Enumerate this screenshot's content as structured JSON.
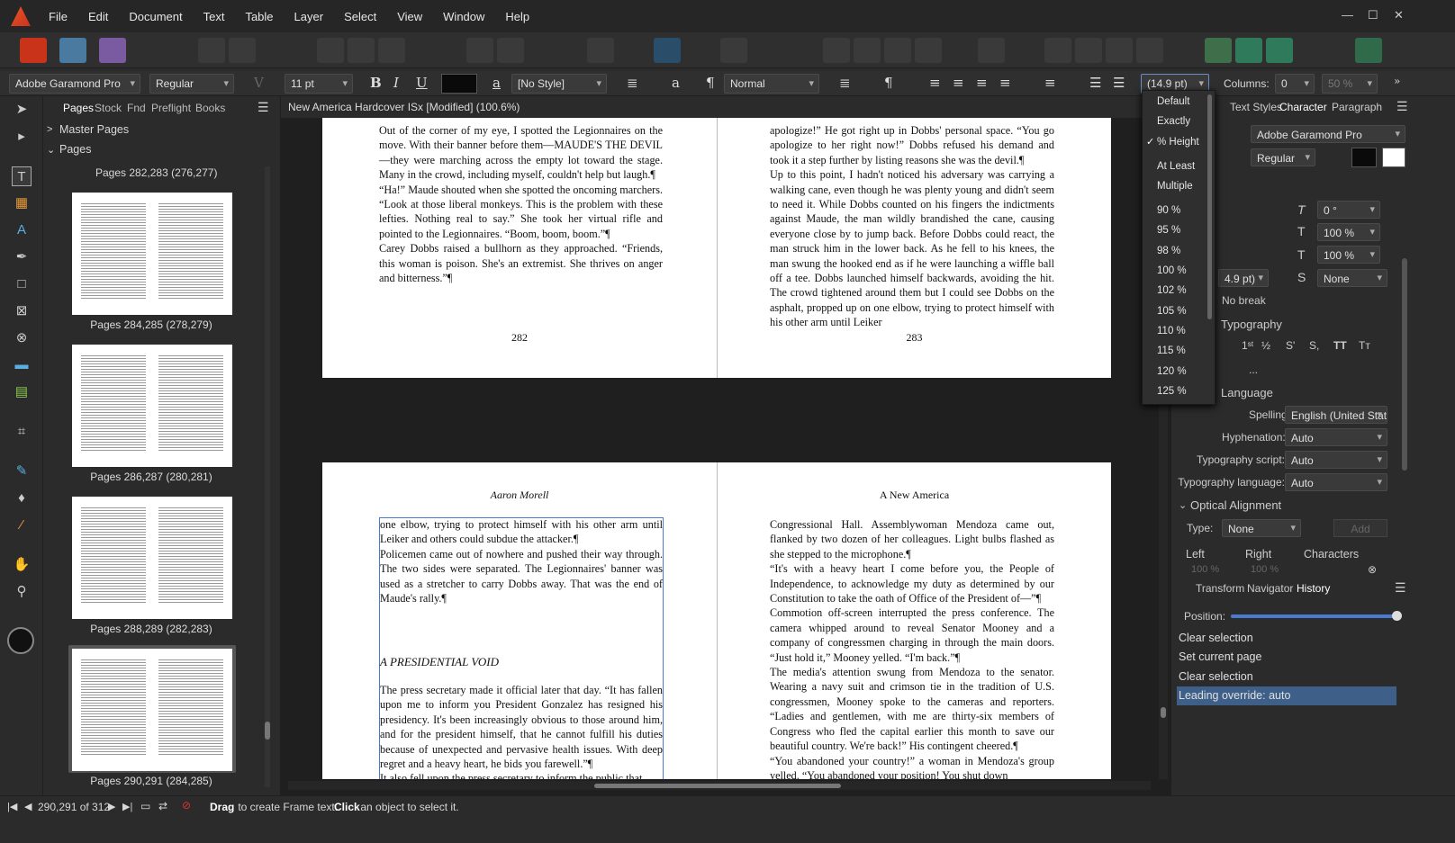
{
  "menu": {
    "items": [
      "File",
      "Edit",
      "Document",
      "Text",
      "Table",
      "Layer",
      "Select",
      "View",
      "Window",
      "Help"
    ]
  },
  "context_bar": {
    "font_family": "Adobe Garamond Pro",
    "font_style": "Regular",
    "font_size": "11 pt",
    "char_style": "[No Style]",
    "para_style": "Normal",
    "leading": "(14.9 pt)",
    "columns_label": "Columns:",
    "columns_value": "0",
    "zoom_pct": "50 %"
  },
  "left_panel": {
    "tabs": [
      "Pages",
      "Stock",
      "Fnd",
      "Preflight",
      "Books"
    ],
    "master_pages": "Master Pages",
    "pages": "Pages",
    "spreads": [
      "Pages 282,283 (276,277)",
      "Pages 284,285 (278,279)",
      "Pages 286,287 (280,281)",
      "Pages 288,289 (282,283)",
      "Pages 290,291 (284,285)"
    ]
  },
  "document": {
    "title": "New America Hardcover ISx [Modified] (100.6%)",
    "page282": "Out of the corner of my eye, I spotted the Legionnaires on the move. With their banner before them—MAUDE'S THE DEVIL—they were marching across the empty lot toward the stage. Many in the crowd, including myself, couldn't help but laugh.¶\n“Ha!” Maude shouted when she spotted the oncoming marchers. “Look at those liberal monkeys. This is the problem with these lefties. Nothing real to say.” She took her virtual rifle and pointed to the Legionnaires. “Boom, boom, boom.”¶\nCarey Dobbs raised a bullhorn as they approached. “Friends, this woman is poison. She's an extremist. She thrives on anger and bitterness.”¶",
    "page283": "apologize!” He got right up in Dobbs' personal space. “You go apologize to her right now!” Dobbs refused his demand and took it a step further by listing reasons she was the devil.¶\nUp to this point, I hadn't noticed his adversary was carrying a walking cane, even though he was plenty young and didn't seem to need it. While Dobbs counted on his fingers the indictments against Maude, the man wildly brandished the cane, causing everyone close by to jump back. Before Dobbs could react, the man struck him in the lower back. As he fell to his knees, the man swung the hooked end as if he were launching a wiffle ball off a tee. Dobbs launched himself backwards, avoiding the hit. The crowd tightened around them but I could see Dobbs on the asphalt, propped up on one elbow, trying to protect himself with his other arm until Leiker",
    "pn282": "282",
    "pn283": "283",
    "header_left": "Aaron Morell",
    "header_right": "A New America",
    "page284a": "one elbow, trying to protect himself with his other arm until Leiker and others could subdue the attacker.¶\nPolicemen came out of nowhere and pushed their way through. The two sides were separated. The Legionnaires' banner was used as a stretcher to carry Dobbs away. That was the end of Maude's rally.¶",
    "heading284": "A PRESIDENTIAL VOID",
    "page284b": "The press secretary made it official later that day. “It has fallen upon me to inform you President Gonzalez has resigned his presidency. It's been increasingly obvious to those around him, and for the president himself, that he cannot fulfill his duties because of unexpected and pervasive health issues. With deep regret and a heavy heart, he bids you farewell.”¶\nIt also fell upon the press secretary to inform the public that",
    "page285": "Congressional Hall. Assemblywoman Mendoza came out, flanked by two dozen of her colleagues. Light bulbs flashed as she stepped to the microphone.¶\n“It's with a heavy heart I come before you, the People of Independence, to acknowledge my duty as determined by our Constitution to take the oath of Office of the President of—”¶\nCommotion off-screen interrupted the press conference. The camera whipped around to reveal Senator Mooney and a company of congressmen charging in through the main doors. “Just hold it,” Mooney yelled. “I'm back.”¶\nThe media's attention swung from Mendoza to the senator. Wearing a navy suit and crimson tie in the tradition of U.S. congressmen, Mooney spoke to the cameras and reporters. “Ladies and gentlemen, with me are thirty-six members of Congress who fled the capital earlier this month to save our beautiful country. We're back!” His contingent cheered.¶\n“You abandoned your country!” a woman in Mendoza's group yelled. “You abandoned your position! You shut down"
  },
  "leading_menu": {
    "items": [
      "Default",
      "Exactly",
      "% Height",
      "At Least",
      "Multiple",
      "90 %",
      "95 %",
      "98 %",
      "100 %",
      "102 %",
      "105 %",
      "110 %",
      "115 %",
      "120 %",
      "125 %"
    ],
    "checked": "% Height"
  },
  "right_panel": {
    "tabs": [
      "Text Styles",
      "Character",
      "Paragraph"
    ],
    "font": "Adobe Garamond Pro",
    "style": "Regular",
    "skew": "0 °",
    "scale_h": "100 %",
    "scale_v": "100 %",
    "leading_val": "4.9 pt)",
    "strikethrough": "None",
    "no_break": "No break",
    "section_typography": "Typography",
    "section_language": "Language",
    "spelling_label": "Spelling:",
    "spelling": "English (United States)",
    "hyphenation_label": "Hyphenation:",
    "hyphenation": "Auto",
    "typo_script_label": "Typography script:",
    "typo_script": "Auto",
    "typo_lang_label": "Typography language:",
    "typo_lang": "Auto",
    "optical_title": "Optical Alignment",
    "type_label": "Type:",
    "type_value": "None",
    "add_btn": "Add",
    "cols": [
      "Left",
      "Right",
      "Characters"
    ],
    "col_vals": [
      "100 %",
      "100 %"
    ],
    "bottom_tabs": [
      "Transform",
      "Navigator",
      "History"
    ],
    "position_label": "Position:",
    "history": [
      "Clear selection",
      "Set current page",
      "Clear selection",
      "Leading override: auto"
    ]
  },
  "status": {
    "pages": "290,291 of 312",
    "hint_bold1": "Drag",
    "hint1": " to create Frame text. ",
    "hint_bold2": "Click",
    "hint2": " an object to select it."
  }
}
